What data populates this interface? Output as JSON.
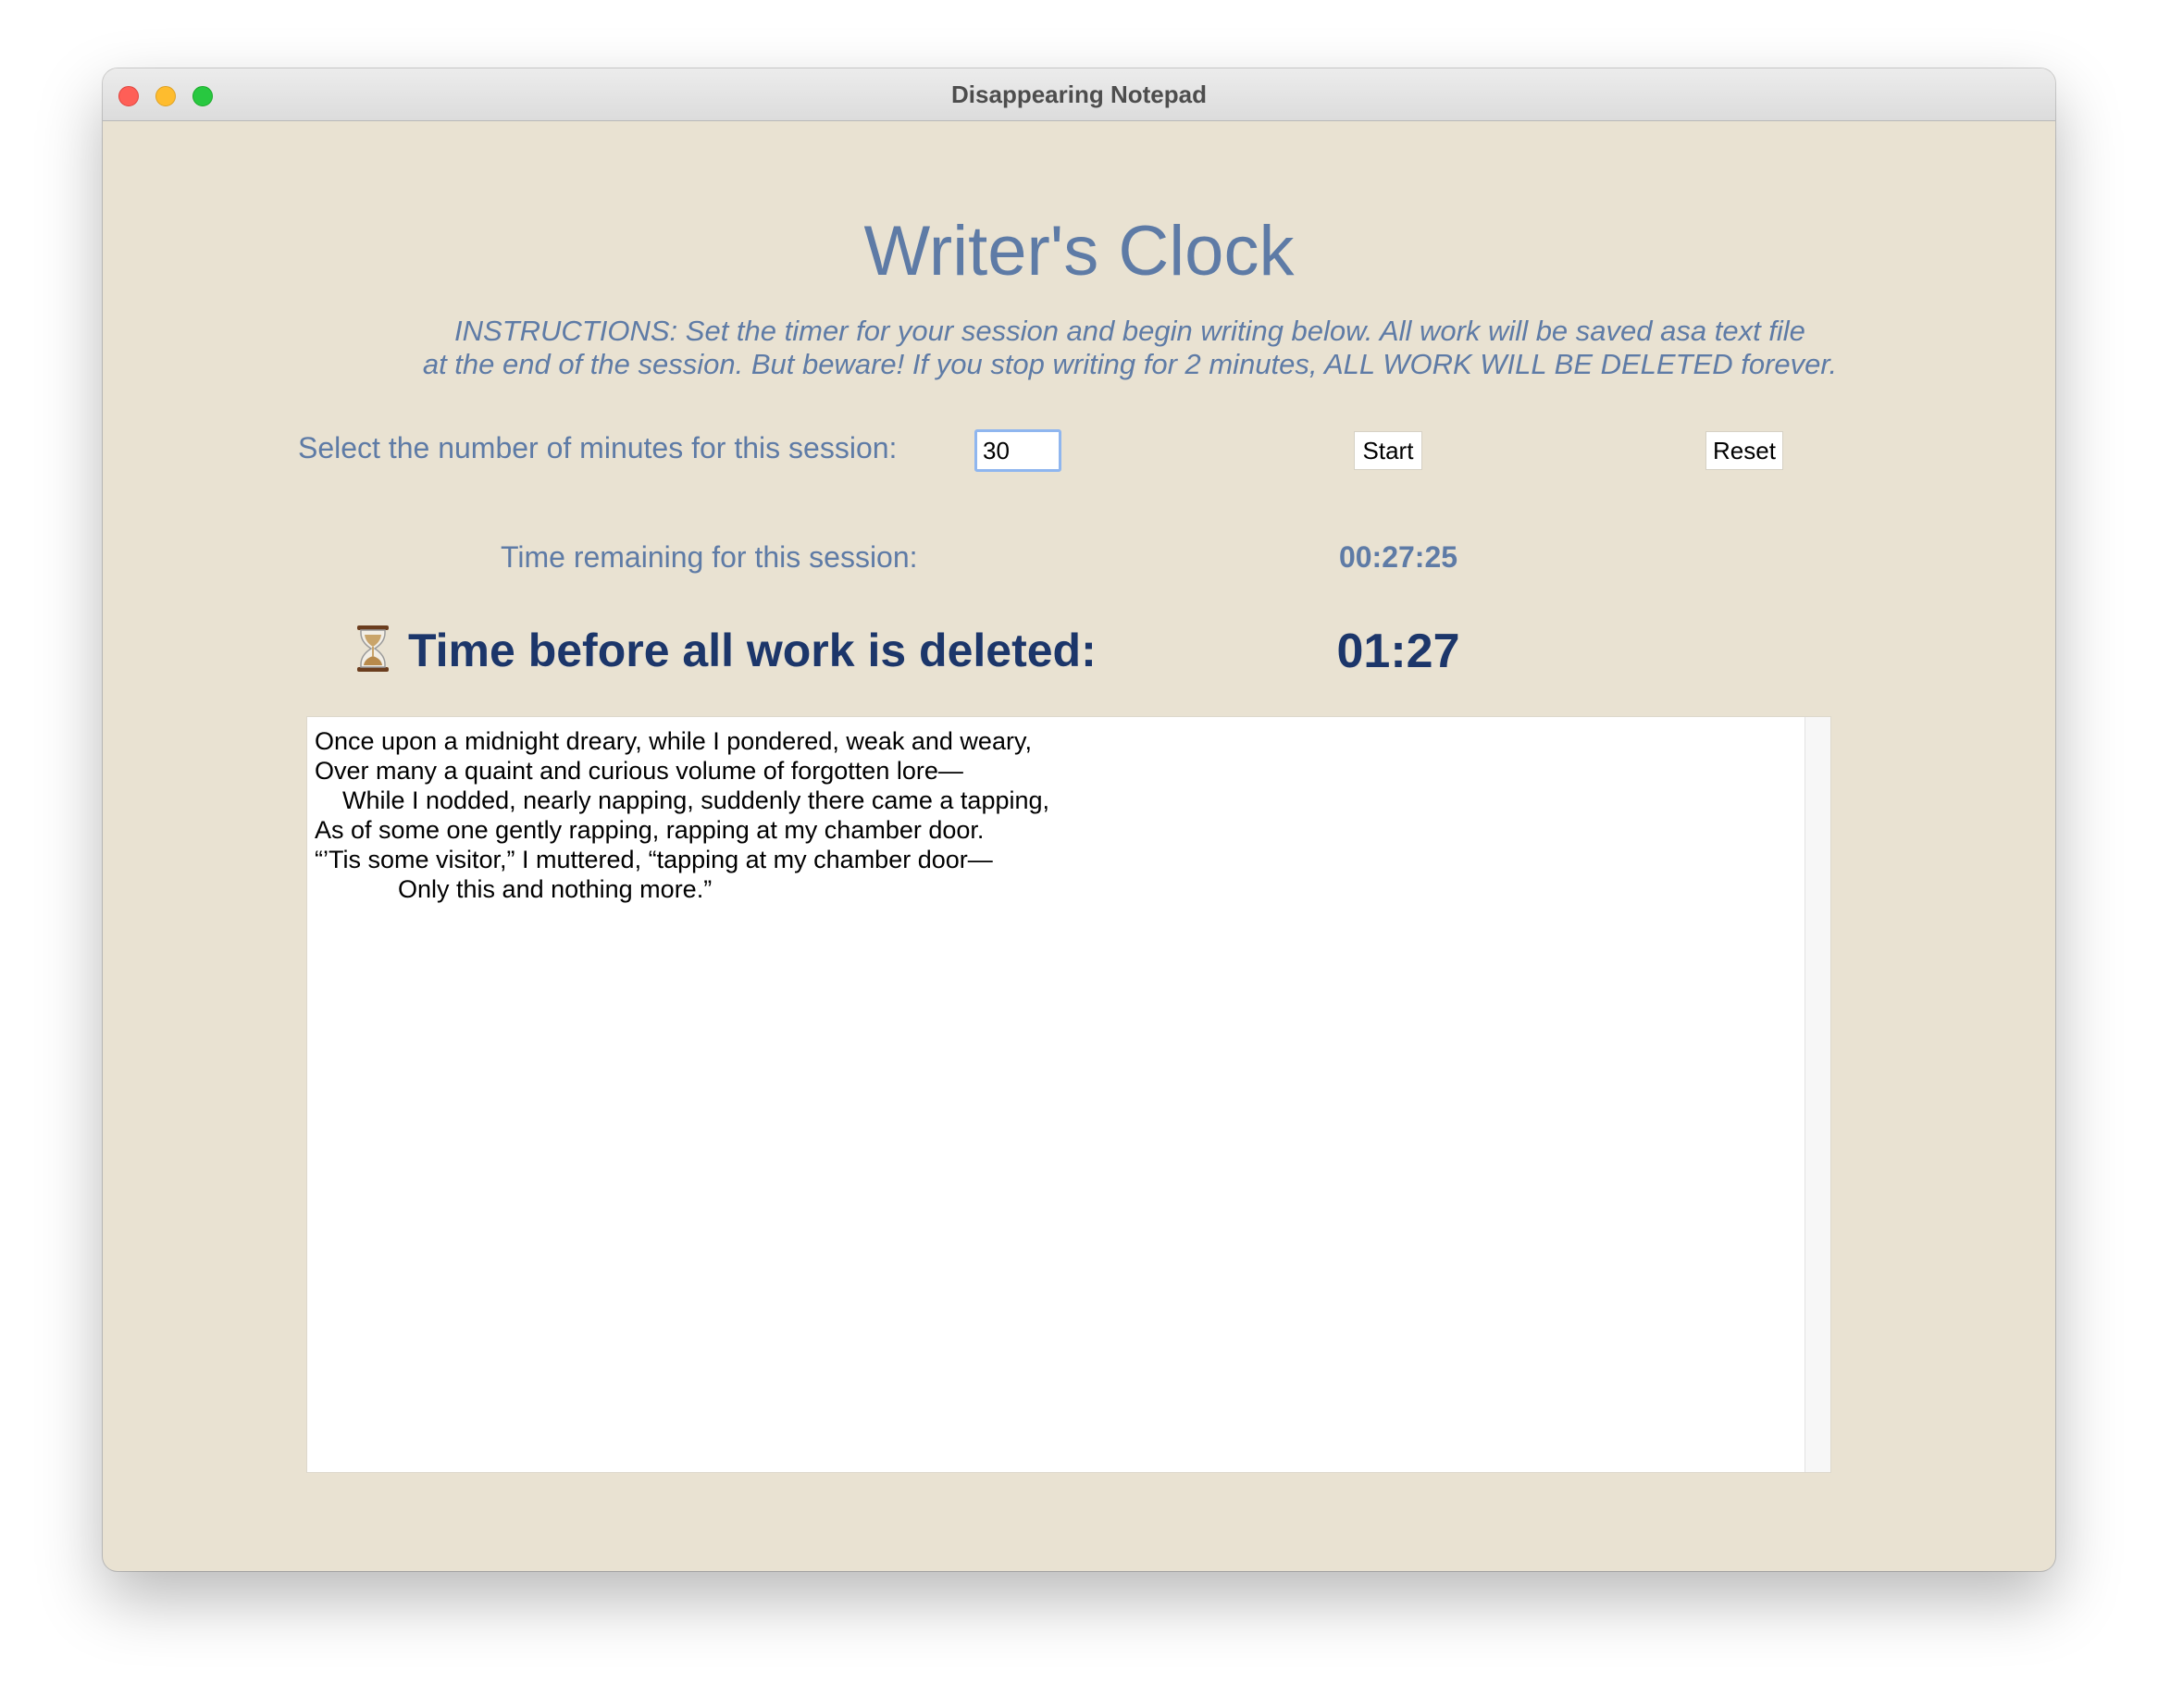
{
  "window": {
    "title": "Disappearing Notepad"
  },
  "app": {
    "heading": "Writer's Clock",
    "instructions_line1": "INSTRUCTIONS: Set the timer for your session and begin writing below. All work will be saved asa text file",
    "instructions_line2": "at the end of the session. But beware! If you stop writing for 2 minutes, ALL WORK WILL BE DELETED forever."
  },
  "session": {
    "minutes_label": "Select the number of minutes for this session:",
    "minutes_value": "30",
    "start_label": "Start",
    "reset_label": "Reset",
    "remaining_label": "Time remaining for this session:",
    "remaining_value": "00:27:25"
  },
  "deletion": {
    "icon": "hourglass-icon",
    "label": "Time before all work is deleted:",
    "value": "01:27"
  },
  "editor": {
    "text": "Once upon a midnight dreary, while I pondered, weak and weary,\nOver many a quaint and curious volume of forgotten lore—\n    While I nodded, nearly napping, suddenly there came a tapping,\nAs of some one gently rapping, rapping at my chamber door.\n“’Tis some visitor,” I muttered, “tapping at my chamber door—\n            Only this and nothing more.”"
  },
  "colors": {
    "background": "#e9e2d2",
    "accent": "#5e7ba6",
    "warning": "#1c366a"
  }
}
